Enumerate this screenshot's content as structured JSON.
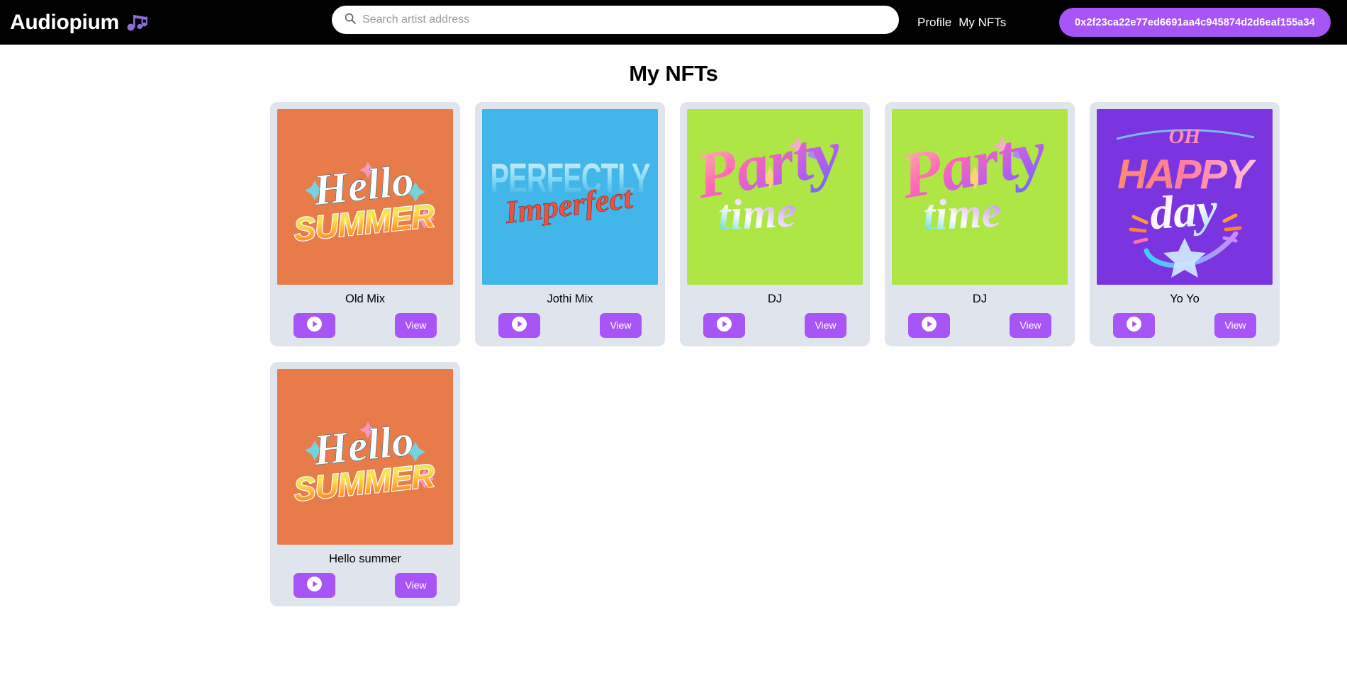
{
  "nav": {
    "brand": "Audiopium",
    "brand_icon": "music-notes-icon",
    "links": [
      {
        "label": "Profile",
        "name": "nav-link-profile"
      },
      {
        "label": "My NFTs",
        "name": "nav-link-my-nfts"
      }
    ],
    "wallet_address": "0x2f23ca22e77ed6691aa4c945874d2d6eaf155a34",
    "wallet_color": "#a855f7"
  },
  "search": {
    "placeholder": "Search artist address",
    "value": "",
    "icon": "search-icon"
  },
  "main": {
    "title": "My NFTs",
    "play_label": "",
    "view_label": "View",
    "play_icon": "play-circle-icon"
  },
  "colors": {
    "navbar_bg": "#000000",
    "page_bg": "#ffffff",
    "card_bg": "#dfe4ed",
    "accent": "#a855f7",
    "art_orange": "#e87b4a",
    "art_blue": "#42b6e8",
    "art_green": "#aee645",
    "art_purple": "#7b35e0"
  },
  "nfts": [
    {
      "name": "Old Mix",
      "art_bg": "#e87b4a",
      "art_kind": "hello-summer",
      "art_lines": [
        "Hello",
        "SUMMER"
      ]
    },
    {
      "name": "Jothi Mix",
      "art_bg": "#42b6e8",
      "art_kind": "perfectly-imperfect",
      "art_lines": [
        "PERFECTLY",
        "Imperfect"
      ]
    },
    {
      "name": "DJ",
      "art_bg": "#aee645",
      "art_kind": "party-time",
      "art_lines": [
        "Party",
        "time"
      ]
    },
    {
      "name": "DJ",
      "art_bg": "#aee645",
      "art_kind": "party-time",
      "art_lines": [
        "Party",
        "time"
      ]
    },
    {
      "name": "Yo Yo",
      "art_bg": "#7b35e0",
      "art_kind": "oh-happy-day",
      "art_lines": [
        "OH",
        "HAPPY",
        "day"
      ]
    },
    {
      "name": "Hello summer",
      "art_bg": "#e87b4a",
      "art_kind": "hello-summer",
      "art_lines": [
        "Hello",
        "SUMMER"
      ]
    }
  ]
}
